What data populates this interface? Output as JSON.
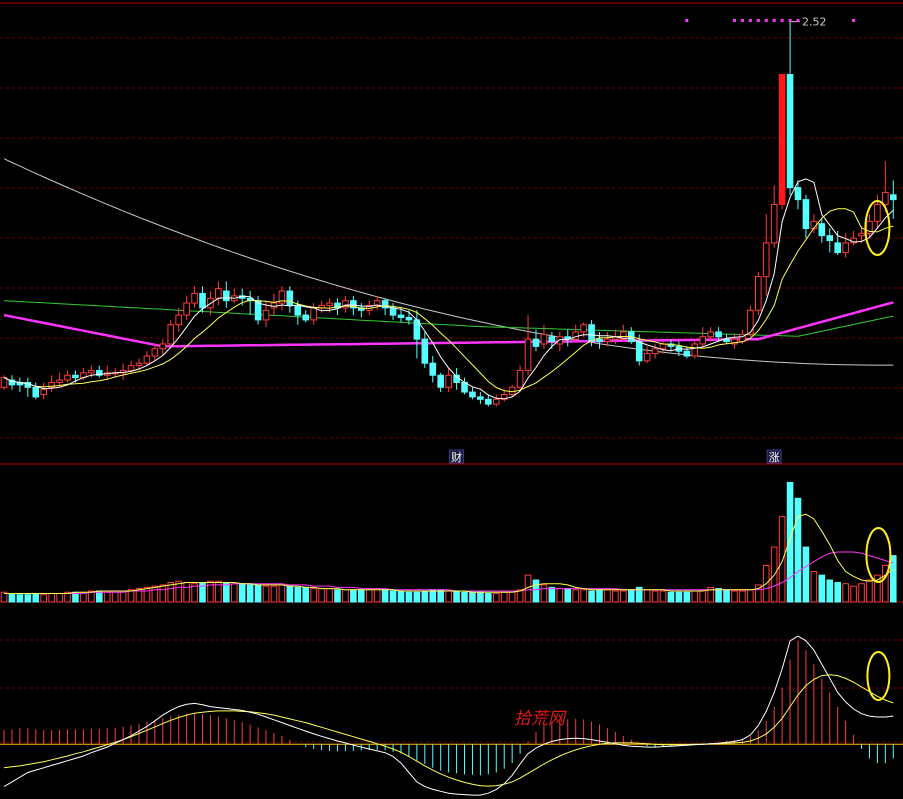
{
  "chart_data": {
    "type": "candlestick",
    "bar_count": 113,
    "colors": {
      "up": "#ff3b3b",
      "down": "#54ffff",
      "limit_up": "#ff1a1a",
      "ma_short": "#ffffff",
      "ma_mid": "#ffff55",
      "ma_long": "#ff33ff",
      "ma_green": "#33cc33",
      "ma_very_long": "#c8c8c8",
      "grid": "#7a0000",
      "separator": "#b30000",
      "highlight_circle": "#ffee22",
      "dots": "#ff33ff"
    },
    "price": {
      "ylim": [
        0.76,
        2.56
      ],
      "high_label": "2.52",
      "high_bar": 99,
      "candles": [
        [
          1.0,
          1.04,
          0.99,
          1.05
        ],
        [
          1.03,
          1.01,
          0.99,
          1.05
        ],
        [
          1.02,
          1.01,
          0.98,
          1.04
        ],
        [
          1.02,
          1.0,
          0.96,
          1.04
        ],
        [
          1.0,
          0.96,
          0.95,
          1.02
        ],
        [
          0.97,
          0.99,
          0.95,
          1.02
        ],
        [
          1.0,
          1.02,
          0.98,
          1.05
        ],
        [
          1.02,
          1.03,
          1.0,
          1.06
        ],
        [
          1.03,
          1.05,
          1.02,
          1.07
        ],
        [
          1.05,
          1.04,
          1.02,
          1.07
        ],
        [
          1.04,
          1.06,
          1.03,
          1.08
        ],
        [
          1.06,
          1.07,
          1.04,
          1.09
        ],
        [
          1.07,
          1.05,
          1.04,
          1.09
        ],
        [
          1.05,
          1.06,
          1.03,
          1.09
        ],
        [
          1.06,
          1.06,
          1.04,
          1.08
        ],
        [
          1.06,
          1.07,
          1.03,
          1.1
        ],
        [
          1.07,
          1.09,
          1.06,
          1.11
        ],
        [
          1.09,
          1.1,
          1.07,
          1.12
        ],
        [
          1.1,
          1.13,
          1.09,
          1.15
        ],
        [
          1.13,
          1.16,
          1.11,
          1.18
        ],
        [
          1.16,
          1.18,
          1.13,
          1.2
        ],
        [
          1.18,
          1.26,
          1.16,
          1.28
        ],
        [
          1.26,
          1.3,
          1.23,
          1.33
        ],
        [
          1.3,
          1.35,
          1.28,
          1.38
        ],
        [
          1.35,
          1.39,
          1.33,
          1.42
        ],
        [
          1.39,
          1.33,
          1.31,
          1.42
        ],
        [
          1.33,
          1.37,
          1.3,
          1.4
        ],
        [
          1.37,
          1.41,
          1.34,
          1.44
        ],
        [
          1.4,
          1.36,
          1.33,
          1.44
        ],
        [
          1.36,
          1.38,
          1.35,
          1.41
        ],
        [
          1.38,
          1.37,
          1.34,
          1.41
        ],
        [
          1.37,
          1.36,
          1.3,
          1.4
        ],
        [
          1.36,
          1.28,
          1.26,
          1.38
        ],
        [
          1.28,
          1.32,
          1.25,
          1.36
        ],
        [
          1.33,
          1.35,
          1.3,
          1.39
        ],
        [
          1.35,
          1.4,
          1.32,
          1.42
        ],
        [
          1.4,
          1.34,
          1.31,
          1.42
        ],
        [
          1.34,
          1.3,
          1.26,
          1.36
        ],
        [
          1.3,
          1.28,
          1.27,
          1.32
        ],
        [
          1.28,
          1.33,
          1.26,
          1.35
        ],
        [
          1.33,
          1.34,
          1.31,
          1.36
        ],
        [
          1.34,
          1.35,
          1.31,
          1.37
        ],
        [
          1.35,
          1.33,
          1.3,
          1.37
        ],
        [
          1.33,
          1.36,
          1.31,
          1.38
        ],
        [
          1.36,
          1.33,
          1.3,
          1.38
        ],
        [
          1.33,
          1.32,
          1.29,
          1.35
        ],
        [
          1.32,
          1.34,
          1.3,
          1.36
        ],
        [
          1.34,
          1.36,
          1.32,
          1.38
        ],
        [
          1.36,
          1.33,
          1.3,
          1.37
        ],
        [
          1.33,
          1.3,
          1.28,
          1.35
        ],
        [
          1.3,
          1.29,
          1.27,
          1.33
        ],
        [
          1.29,
          1.28,
          1.26,
          1.32
        ],
        [
          1.28,
          1.2,
          1.12,
          1.32
        ],
        [
          1.2,
          1.1,
          1.08,
          1.23
        ],
        [
          1.1,
          1.05,
          1.02,
          1.13
        ],
        [
          1.05,
          1.0,
          0.98,
          1.06
        ],
        [
          1.0,
          1.05,
          0.98,
          1.08
        ],
        [
          1.05,
          1.02,
          0.99,
          1.08
        ],
        [
          1.02,
          0.98,
          0.97,
          1.04
        ],
        [
          0.98,
          0.96,
          0.95,
          1.0
        ],
        [
          0.96,
          0.95,
          0.93,
          0.98
        ],
        [
          0.95,
          0.93,
          0.92,
          0.97
        ],
        [
          0.93,
          0.95,
          0.92,
          0.97
        ],
        [
          0.95,
          0.97,
          0.94,
          0.99
        ],
        [
          0.97,
          1.0,
          0.96,
          1.01
        ],
        [
          1.0,
          1.07,
          0.99,
          1.09
        ],
        [
          1.07,
          1.2,
          1.05,
          1.3
        ],
        [
          1.2,
          1.17,
          1.15,
          1.24
        ],
        [
          1.18,
          1.22,
          1.16,
          1.26
        ],
        [
          1.21,
          1.19,
          1.16,
          1.23
        ],
        [
          1.18,
          1.21,
          1.15,
          1.23
        ],
        [
          1.21,
          1.2,
          1.17,
          1.24
        ],
        [
          1.2,
          1.23,
          1.19,
          1.26
        ],
        [
          1.23,
          1.26,
          1.21,
          1.27
        ],
        [
          1.26,
          1.19,
          1.17,
          1.28
        ],
        [
          1.2,
          1.19,
          1.16,
          1.23
        ],
        [
          1.19,
          1.2,
          1.17,
          1.23
        ],
        [
          1.2,
          1.21,
          1.18,
          1.24
        ],
        [
          1.2,
          1.23,
          1.19,
          1.26
        ],
        [
          1.23,
          1.19,
          1.18,
          1.25
        ],
        [
          1.19,
          1.11,
          1.09,
          1.22
        ],
        [
          1.11,
          1.14,
          1.1,
          1.17
        ],
        [
          1.14,
          1.16,
          1.12,
          1.18
        ],
        [
          1.16,
          1.18,
          1.14,
          1.19
        ],
        [
          1.18,
          1.17,
          1.15,
          1.2
        ],
        [
          1.17,
          1.15,
          1.13,
          1.19
        ],
        [
          1.15,
          1.13,
          1.12,
          1.17
        ],
        [
          1.13,
          1.18,
          1.12,
          1.2
        ],
        [
          1.18,
          1.21,
          1.17,
          1.25
        ],
        [
          1.21,
          1.23,
          1.19,
          1.25
        ],
        [
          1.23,
          1.21,
          1.19,
          1.25
        ],
        [
          1.2,
          1.19,
          1.18,
          1.22
        ],
        [
          1.18,
          1.2,
          1.16,
          1.22
        ],
        [
          1.19,
          1.22,
          1.18,
          1.24
        ],
        [
          1.22,
          1.32,
          1.21,
          1.34
        ],
        [
          1.32,
          1.46,
          1.3,
          1.48
        ],
        [
          1.46,
          1.6,
          1.38,
          1.72
        ],
        [
          1.6,
          1.76,
          1.58,
          1.84
        ],
        [
          1.76,
          2.3,
          1.74,
          2.3
        ],
        [
          2.3,
          1.83,
          1.8,
          2.52
        ],
        [
          1.83,
          1.78,
          1.74,
          1.86
        ],
        [
          1.78,
          1.66,
          1.62,
          1.8
        ],
        [
          1.66,
          1.69,
          1.64,
          1.72
        ],
        [
          1.68,
          1.63,
          1.6,
          1.7
        ],
        [
          1.63,
          1.61,
          1.56,
          1.66
        ],
        [
          1.6,
          1.56,
          1.55,
          1.65
        ],
        [
          1.56,
          1.6,
          1.54,
          1.64
        ],
        [
          1.6,
          1.62,
          1.59,
          1.65
        ],
        [
          1.63,
          1.64,
          1.6,
          1.67
        ],
        [
          1.64,
          1.69,
          1.62,
          1.72
        ],
        [
          1.69,
          1.76,
          1.66,
          1.8
        ],
        [
          1.76,
          1.81,
          1.73,
          1.94
        ],
        [
          1.8,
          1.78,
          1.7,
          1.86
        ]
      ],
      "highlight_circle_at_bar": 110,
      "event_labels": [
        {
          "text": "财",
          "bar": 57
        },
        {
          "text": "涨",
          "bar": 97
        }
      ],
      "dot_bars": [
        86,
        92,
        93,
        94,
        95,
        96,
        97,
        98,
        99,
        100,
        107
      ]
    },
    "volume": {
      "ylim": [
        0,
        100
      ],
      "highlight_circle_at_bar": 110,
      "values": [
        8,
        7,
        6,
        6,
        7,
        6,
        7,
        7,
        8,
        8,
        8,
        9,
        9,
        8,
        9,
        9,
        10,
        11,
        12,
        13,
        14,
        16,
        17,
        16,
        15,
        16,
        17,
        17,
        16,
        15,
        15,
        14,
        14,
        13,
        13,
        14,
        13,
        12,
        12,
        11,
        11,
        11,
        10,
        10,
        10,
        10,
        10,
        11,
        10,
        9,
        9,
        8,
        8,
        9,
        10,
        10,
        9,
        9,
        8,
        8,
        8,
        7,
        7,
        8,
        9,
        10,
        22,
        18,
        14,
        12,
        11,
        11,
        10,
        10,
        9,
        10,
        10,
        9,
        9,
        10,
        12,
        10,
        9,
        9,
        8,
        8,
        8,
        9,
        10,
        12,
        11,
        10,
        9,
        9,
        10,
        14,
        30,
        45,
        70,
        98,
        85,
        45,
        25,
        22,
        18,
        16,
        15,
        13,
        15,
        18,
        22,
        30,
        38
      ],
      "ma_fast": [
        7,
        7,
        7,
        7,
        7,
        7,
        7,
        7,
        7,
        8,
        8,
        8,
        9,
        9,
        9,
        9,
        9,
        10,
        11,
        12,
        13,
        14,
        15,
        16,
        16,
        16,
        16,
        16,
        16,
        16,
        15,
        15,
        14,
        14,
        14,
        14,
        13,
        13,
        12,
        12,
        11,
        11,
        11,
        10,
        10,
        10,
        10,
        10,
        10,
        10,
        9,
        9,
        9,
        9,
        9,
        9,
        9,
        9,
        9,
        8,
        8,
        8,
        8,
        8,
        8,
        9,
        12,
        14,
        15,
        15,
        15,
        14,
        12,
        11,
        10,
        10,
        10,
        10,
        10,
        10,
        10,
        10,
        10,
        10,
        9,
        9,
        9,
        9,
        9,
        10,
        10,
        10,
        10,
        10,
        10,
        11,
        15,
        22,
        33,
        52,
        70,
        72,
        68,
        58,
        47,
        34,
        25,
        21,
        18,
        17,
        18,
        22,
        27
      ],
      "ma_slow": [
        7,
        7,
        7,
        7,
        7,
        7,
        7,
        7,
        7,
        7,
        7,
        8,
        8,
        8,
        8,
        8,
        9,
        9,
        9,
        10,
        10,
        11,
        12,
        12,
        13,
        13,
        14,
        14,
        14,
        15,
        15,
        15,
        15,
        15,
        15,
        15,
        14,
        14,
        14,
        13,
        13,
        13,
        12,
        12,
        12,
        11,
        11,
        11,
        11,
        10,
        10,
        10,
        10,
        10,
        10,
        10,
        10,
        9,
        9,
        9,
        9,
        9,
        9,
        9,
        9,
        9,
        10,
        10,
        11,
        11,
        11,
        11,
        11,
        11,
        11,
        11,
        11,
        11,
        10,
        10,
        10,
        10,
        10,
        10,
        10,
        10,
        10,
        10,
        10,
        10,
        10,
        10,
        10,
        10,
        10,
        10,
        11,
        13,
        16,
        20,
        25,
        29,
        33,
        37,
        40,
        41,
        41,
        41,
        40,
        38,
        36,
        34,
        32
      ]
    },
    "macd": {
      "ylim": [
        -0.11,
        0.26
      ],
      "highlight_circle_at_bar": 110,
      "bars": [
        0.03,
        0.032,
        0.035,
        0.034,
        0.032,
        0.03,
        0.03,
        0.031,
        0.032,
        0.032,
        0.032,
        0.033,
        0.033,
        0.034,
        0.035,
        0.037,
        0.04,
        0.043,
        0.047,
        0.051,
        0.056,
        0.06,
        0.063,
        0.065,
        0.066,
        0.064,
        0.062,
        0.059,
        0.055,
        0.051,
        0.047,
        0.042,
        0.036,
        0.03,
        0.024,
        0.018,
        0.01,
        0.002,
        -0.006,
        -0.01,
        -0.013,
        -0.014,
        -0.015,
        -0.014,
        -0.014,
        -0.013,
        -0.012,
        -0.012,
        -0.013,
        -0.016,
        -0.02,
        -0.026,
        -0.034,
        -0.042,
        -0.05,
        -0.056,
        -0.06,
        -0.062,
        -0.064,
        -0.065,
        -0.066,
        -0.064,
        -0.06,
        -0.052,
        -0.04,
        -0.02,
        0.006,
        0.026,
        0.04,
        0.046,
        0.05,
        0.053,
        0.054,
        0.053,
        0.048,
        0.042,
        0.034,
        0.026,
        0.018,
        0.01,
        0.002,
        -0.004,
        -0.006,
        -0.005,
        -0.004,
        -0.003,
        -0.002,
        -0.001,
        0.001,
        0.003,
        0.006,
        0.008,
        0.01,
        0.012,
        0.018,
        0.03,
        0.05,
        0.08,
        0.12,
        0.18,
        0.22,
        0.2,
        0.17,
        0.14,
        0.11,
        0.08,
        0.05,
        0.02,
        -0.01,
        -0.03,
        -0.04,
        -0.04,
        -0.03
      ],
      "dif": [
        -0.09,
        -0.08,
        -0.07,
        -0.06,
        -0.055,
        -0.05,
        -0.045,
        -0.04,
        -0.035,
        -0.03,
        -0.025,
        -0.018,
        -0.012,
        -0.006,
        0.002,
        0.01,
        0.018,
        0.028,
        0.038,
        0.05,
        0.062,
        0.072,
        0.08,
        0.085,
        0.087,
        0.084,
        0.08,
        0.078,
        0.076,
        0.074,
        0.072,
        0.068,
        0.064,
        0.058,
        0.052,
        0.046,
        0.04,
        0.034,
        0.028,
        0.022,
        0.017,
        0.012,
        0.007,
        0.003,
        -0.002,
        -0.006,
        -0.01,
        -0.014,
        -0.018,
        -0.026,
        -0.04,
        -0.06,
        -0.08,
        -0.09,
        -0.096,
        -0.1,
        -0.104,
        -0.106,
        -0.107,
        -0.108,
        -0.108,
        -0.104,
        -0.096,
        -0.084,
        -0.066,
        -0.042,
        -0.02,
        -0.008,
        0.0,
        0.006,
        0.01,
        0.012,
        0.013,
        0.012,
        0.01,
        0.007,
        0.004,
        0.001,
        -0.002,
        -0.004,
        -0.005,
        -0.006,
        -0.006,
        -0.005,
        -0.004,
        -0.003,
        -0.002,
        -0.001,
        0.0,
        0.001,
        0.002,
        0.004,
        0.006,
        0.01,
        0.02,
        0.04,
        0.07,
        0.11,
        0.16,
        0.22,
        0.23,
        0.22,
        0.2,
        0.17,
        0.14,
        0.11,
        0.09,
        0.075,
        0.065,
        0.06,
        0.058,
        0.058,
        0.06
      ],
      "dea": [
        -0.05,
        -0.048,
        -0.046,
        -0.043,
        -0.04,
        -0.037,
        -0.033,
        -0.029,
        -0.025,
        -0.02,
        -0.016,
        -0.011,
        -0.006,
        -0.001,
        0.004,
        0.01,
        0.016,
        0.023,
        0.03,
        0.037,
        0.044,
        0.051,
        0.057,
        0.062,
        0.066,
        0.068,
        0.07,
        0.071,
        0.071,
        0.071,
        0.07,
        0.069,
        0.067,
        0.065,
        0.062,
        0.058,
        0.054,
        0.05,
        0.046,
        0.041,
        0.036,
        0.031,
        0.026,
        0.021,
        0.016,
        0.011,
        0.006,
        0.001,
        -0.004,
        -0.01,
        -0.017,
        -0.026,
        -0.036,
        -0.046,
        -0.055,
        -0.063,
        -0.07,
        -0.076,
        -0.081,
        -0.085,
        -0.088,
        -0.089,
        -0.088,
        -0.085,
        -0.08,
        -0.072,
        -0.062,
        -0.052,
        -0.042,
        -0.033,
        -0.025,
        -0.018,
        -0.012,
        -0.007,
        -0.003,
        0.0,
        0.002,
        0.003,
        0.003,
        0.003,
        0.002,
        0.001,
        0.0,
        -0.001,
        -0.001,
        -0.001,
        -0.001,
        0.0,
        0.0,
        0.001,
        0.001,
        0.002,
        0.003,
        0.004,
        0.007,
        0.013,
        0.022,
        0.036,
        0.055,
        0.08,
        0.105,
        0.125,
        0.138,
        0.146,
        0.148,
        0.146,
        0.14,
        0.132,
        0.122,
        0.112,
        0.102,
        0.094,
        0.088
      ]
    }
  },
  "watermark": "拾荒网"
}
